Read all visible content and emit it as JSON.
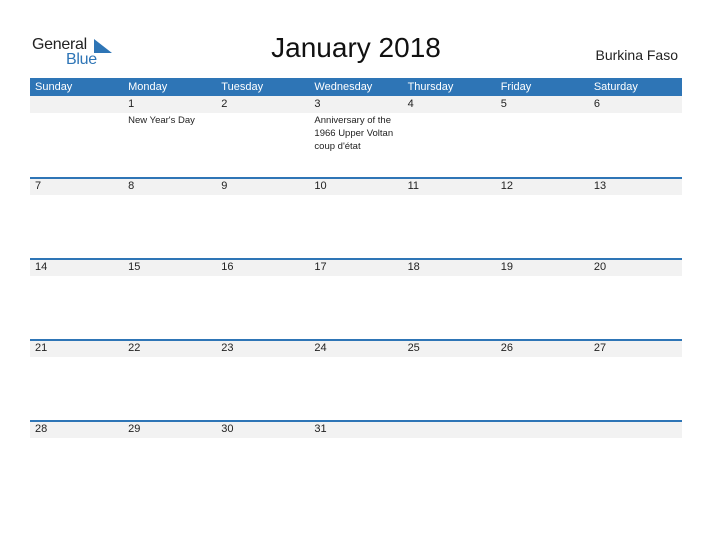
{
  "logo": {
    "line1": "General",
    "line2": "Blue"
  },
  "title": "January 2018",
  "country": "Burkina Faso",
  "colors": {
    "accent": "#2e75b6",
    "band": "#f2f2f2"
  },
  "weekdays": [
    "Sunday",
    "Monday",
    "Tuesday",
    "Wednesday",
    "Thursday",
    "Friday",
    "Saturday"
  ],
  "weeks": [
    [
      {
        "day": "",
        "event": ""
      },
      {
        "day": "1",
        "event": "New Year's Day"
      },
      {
        "day": "2",
        "event": ""
      },
      {
        "day": "3",
        "event": "Anniversary of the 1966 Upper Voltan coup d'état"
      },
      {
        "day": "4",
        "event": ""
      },
      {
        "day": "5",
        "event": ""
      },
      {
        "day": "6",
        "event": ""
      }
    ],
    [
      {
        "day": "7",
        "event": ""
      },
      {
        "day": "8",
        "event": ""
      },
      {
        "day": "9",
        "event": ""
      },
      {
        "day": "10",
        "event": ""
      },
      {
        "day": "11",
        "event": ""
      },
      {
        "day": "12",
        "event": ""
      },
      {
        "day": "13",
        "event": ""
      }
    ],
    [
      {
        "day": "14",
        "event": ""
      },
      {
        "day": "15",
        "event": ""
      },
      {
        "day": "16",
        "event": ""
      },
      {
        "day": "17",
        "event": ""
      },
      {
        "day": "18",
        "event": ""
      },
      {
        "day": "19",
        "event": ""
      },
      {
        "day": "20",
        "event": ""
      }
    ],
    [
      {
        "day": "21",
        "event": ""
      },
      {
        "day": "22",
        "event": ""
      },
      {
        "day": "23",
        "event": ""
      },
      {
        "day": "24",
        "event": ""
      },
      {
        "day": "25",
        "event": ""
      },
      {
        "day": "26",
        "event": ""
      },
      {
        "day": "27",
        "event": ""
      }
    ],
    [
      {
        "day": "28",
        "event": ""
      },
      {
        "day": "29",
        "event": ""
      },
      {
        "day": "30",
        "event": ""
      },
      {
        "day": "31",
        "event": ""
      },
      {
        "day": "",
        "event": ""
      },
      {
        "day": "",
        "event": ""
      },
      {
        "day": "",
        "event": ""
      }
    ]
  ]
}
